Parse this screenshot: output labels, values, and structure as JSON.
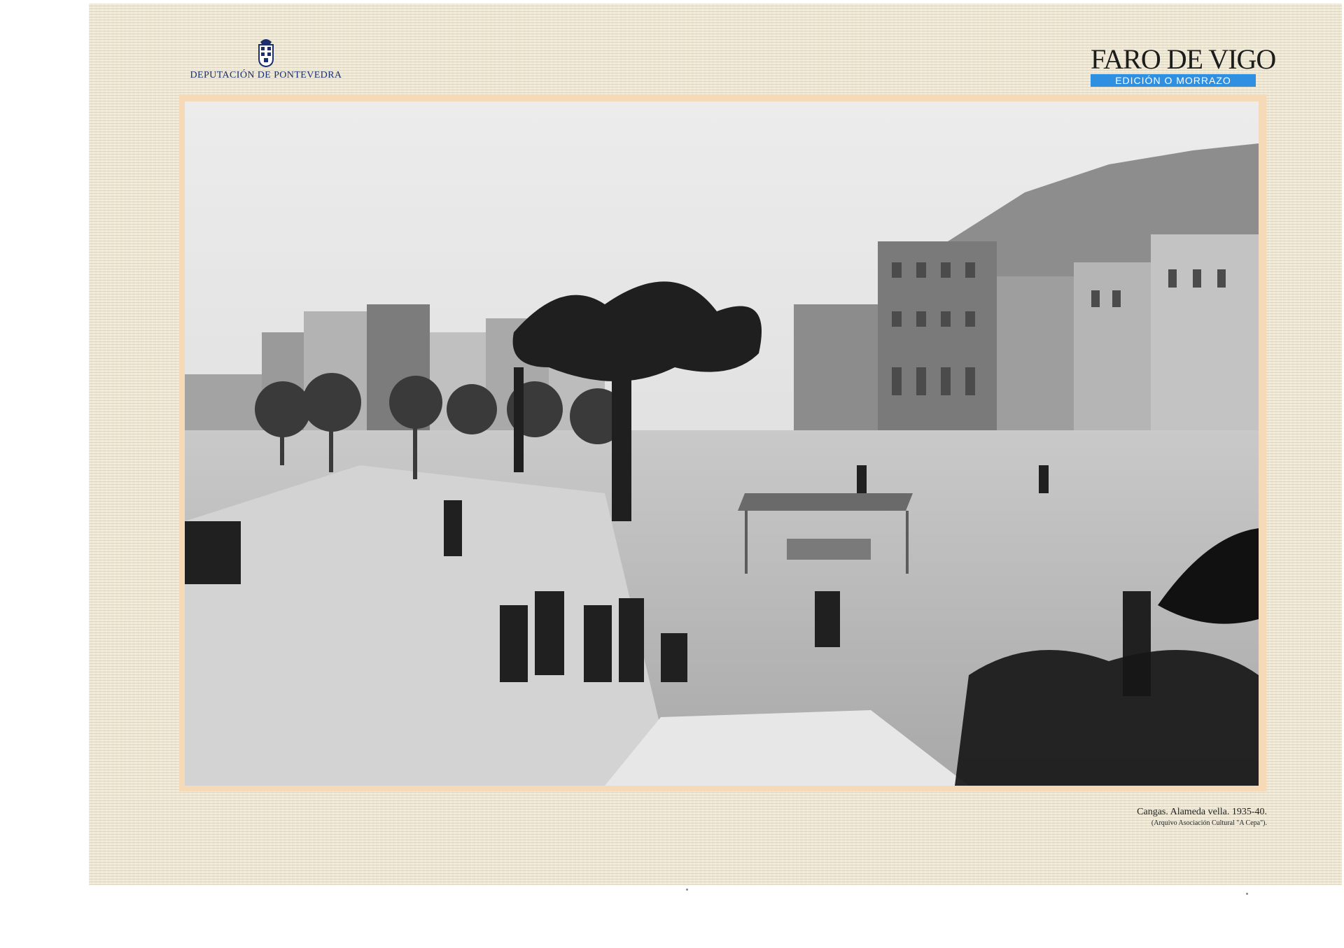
{
  "left_masthead": {
    "org_name": "DEPUTACIÓN DE PONTEVEDRA",
    "crest_icon": "coat-of-arms-icon"
  },
  "right_masthead": {
    "title": "FARO DE VIGO",
    "edition": "EDICIÓN O MORRAZO",
    "edition_color": "#2f8fe0"
  },
  "photo": {
    "kind": "black-and-white historical photograph",
    "scene": "tree-lined promenade with market stalls, people walking, palm trees and buildings"
  },
  "caption": {
    "title": "Cangas. Alameda vella. 1935-40.",
    "credit": "(Arquivo Asociación Cultural \"A Cepa\")."
  }
}
